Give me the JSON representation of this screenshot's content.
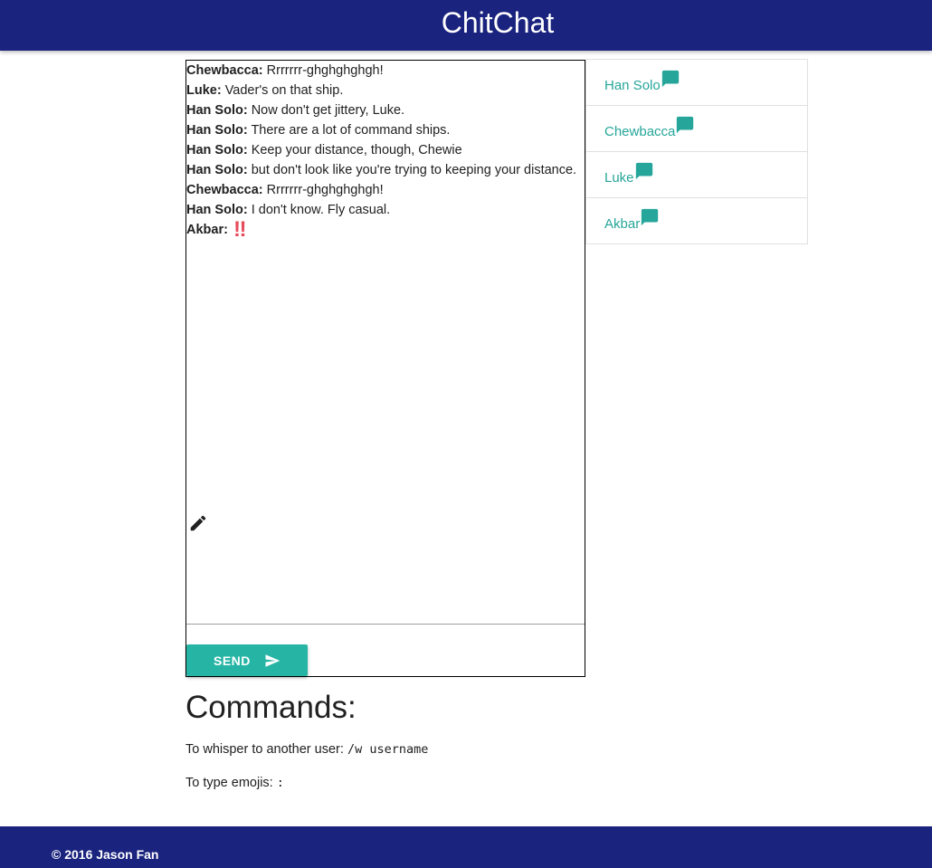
{
  "app": {
    "title": "ChitChat",
    "colors": {
      "primary": "#1a237e",
      "accent": "#26a69a",
      "button": "#26b5a5",
      "emoji": "#e74c5c"
    }
  },
  "chat": {
    "messages": [
      {
        "sender": "Chewbacca:",
        "text": " Rrrrrrr-ghghghghgh!"
      },
      {
        "sender": "Luke:",
        "text": " Vader's on that ship."
      },
      {
        "sender": "Han Solo:",
        "text": " Now don't get jittery, Luke."
      },
      {
        "sender": "Han Solo:",
        "text": " There are a lot of command ships."
      },
      {
        "sender": "Han Solo:",
        "text": " Keep your distance, though, Chewie"
      },
      {
        "sender": "Han Solo:",
        "text": " but don't look like you're trying to keeping your distance."
      },
      {
        "sender": "Chewbacca:",
        "text": " Rrrrrrr-ghghghghgh!"
      },
      {
        "sender": "Han Solo:",
        "text": " I don't know. Fly casual."
      },
      {
        "sender": "Akbar:",
        "text": "",
        "emoji": "‼"
      }
    ],
    "input_value": "",
    "send_label": "SEND",
    "icons": {
      "typing": "pencil-icon",
      "send": "send-icon"
    }
  },
  "users": [
    {
      "name": "Han Solo",
      "icon": "chat-bubble-icon"
    },
    {
      "name": "Chewbacca",
      "icon": "chat-bubble-icon"
    },
    {
      "name": "Luke",
      "icon": "chat-bubble-icon"
    },
    {
      "name": "Akbar",
      "icon": "chat-bubble-icon"
    }
  ],
  "commands": {
    "title": "Commands:",
    "whisper_label": "To whisper to another user: ",
    "whisper_code": "/w username",
    "emoji_label": "To type emojis: ",
    "emoji_code": ":"
  },
  "footer": {
    "text": "© 2016 Jason Fan"
  }
}
